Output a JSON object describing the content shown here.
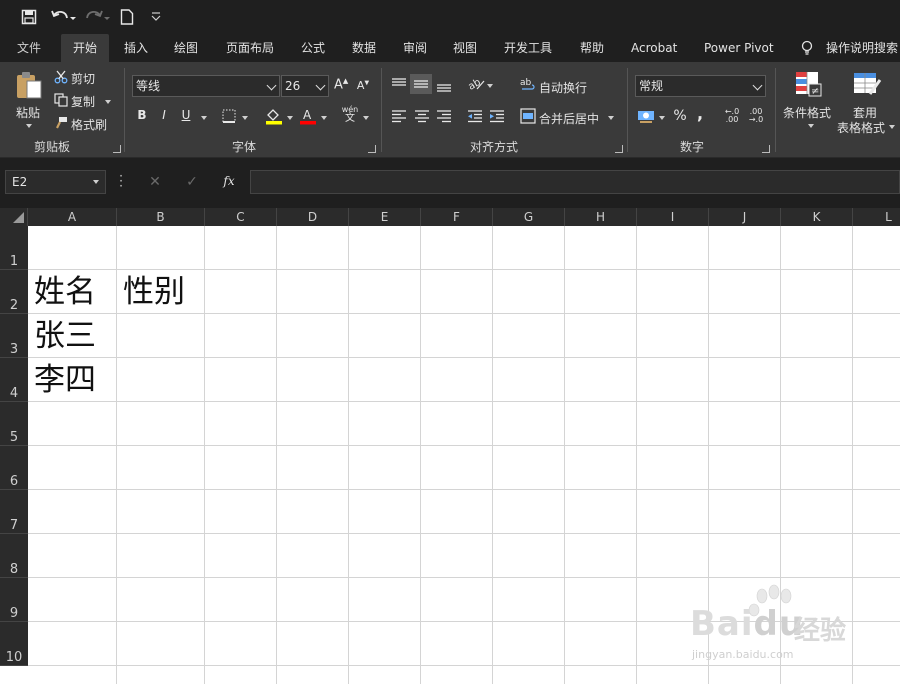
{
  "quick_access": {
    "save_icon": "save-icon",
    "undo_icon": "undo-icon",
    "redo_icon": "redo-icon",
    "new_icon": "new-file-icon",
    "customize_icon": "customize-icon"
  },
  "tabs": [
    "文件",
    "开始",
    "插入",
    "绘图",
    "页面布局",
    "公式",
    "数据",
    "审阅",
    "视图",
    "开发工具",
    "帮助",
    "Acrobat",
    "Power Pivot",
    "操作说明搜索"
  ],
  "ribbon": {
    "clipboard": {
      "label": "剪贴板",
      "paste": "粘贴",
      "cut": "剪切",
      "copy": "复制",
      "format_painter": "格式刷"
    },
    "font": {
      "label": "字体",
      "font_name": "等线",
      "font_size": "26",
      "bold": "B",
      "italic": "I",
      "underline": "U",
      "phonetic": "wén"
    },
    "alignment": {
      "label": "对齐方式",
      "wrap_text": "自动换行",
      "merge_center": "合并后居中"
    },
    "number": {
      "label": "数字",
      "format": "常规",
      "percent": "%",
      "comma": ","
    },
    "styles": {
      "conditional": "条件格式",
      "table_format_line1": "套用",
      "table_format_line2": "表格格式"
    }
  },
  "formula_bar": {
    "name_box": "E2",
    "cancel": "✕",
    "enter": "✓",
    "fx": "fx",
    "content": ""
  },
  "grid": {
    "columns": [
      "A",
      "B",
      "C",
      "D",
      "E",
      "F",
      "G",
      "H",
      "I",
      "J",
      "K",
      "L"
    ],
    "rows": [
      "1",
      "2",
      "3",
      "4",
      "5",
      "6",
      "7",
      "8",
      "9",
      "10"
    ],
    "cells": {
      "A2": "姓名",
      "B2": "性别",
      "A3": "张三",
      "A4": "李四"
    }
  },
  "watermark": {
    "brand": "Bai",
    "brand2": "du",
    "suffix": "经验",
    "url": "jingyan.baidu.com"
  },
  "colors": {
    "ribbon_bg": "#3a3a3a",
    "titlebar_bg": "#1f1f1f",
    "grid_line": "#d4d4d4",
    "highlight_yellow": "#ffff00",
    "font_red": "#ff0000"
  }
}
